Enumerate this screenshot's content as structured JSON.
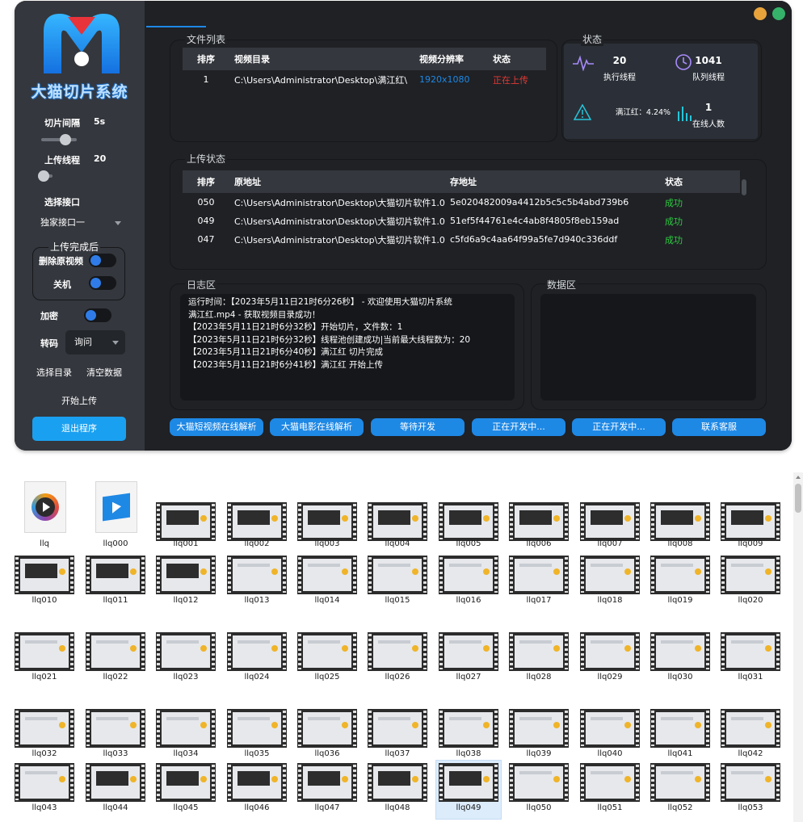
{
  "window": {
    "min_color": "#e8a33b",
    "max_color": "#36b36a"
  },
  "sidebar": {
    "brand": "大猫切片系统",
    "slice_interval_label": "切片间隔",
    "slice_interval_value": "5s",
    "slice_interval_level": 0.55,
    "upload_threads_label": "上传线程",
    "upload_threads_value": "20",
    "upload_threads_level": 0.05,
    "choose_api_label": "选择接口",
    "api_select_value": "独家接口一",
    "after_upload_title": "上传完成后",
    "delete_source_label": "删除原视频",
    "shutdown_label": "关机",
    "encrypt_label": "加密",
    "transcode_label": "转码",
    "transcode_select_value": "询问",
    "choose_dir_label": "选择目录",
    "clear_data_label": "清空数据",
    "start_upload_label": "开始上传",
    "quit_label": "退出程序"
  },
  "file_list": {
    "title": "文件列表",
    "headers": [
      "排序",
      "视频目录",
      "视频分辨率",
      "状态"
    ],
    "rows": [
      {
        "index": "1",
        "dir": "C:\\Users\\Administrator\\Desktop\\满江红\\",
        "resolution": "1920x1080",
        "status": "正在上传"
      }
    ]
  },
  "status": {
    "title": "状态",
    "exec_threads_value": "20",
    "exec_threads_label": "执行线程",
    "queue_threads_value": "1041",
    "queue_threads_label": "队列线程",
    "progress_text": "满江红：4.24%",
    "online_value": "1",
    "online_label": "在线人数"
  },
  "upload_status": {
    "title": "上传状态",
    "headers": [
      "排序",
      "原地址",
      "存地址",
      "状态"
    ],
    "rows": [
      {
        "index": "050",
        "src": "C:\\Users\\Administrator\\Desktop\\大猫切片软件1.0",
        "dst": "5e020482009a4412b5c5c5b4abd739b6",
        "status": "成功"
      },
      {
        "index": "049",
        "src": "C:\\Users\\Administrator\\Desktop\\大猫切片软件1.0",
        "dst": "51ef5f44761e4c4ab8f4805f8eb159ad",
        "status": "成功"
      },
      {
        "index": "047",
        "src": "C:\\Users\\Administrator\\Desktop\\大猫切片软件1.0",
        "dst": "c5fd6a9c4aa64f99a5fe7d940c336ddf",
        "status": "成功"
      }
    ]
  },
  "log": {
    "title": "日志区",
    "lines": [
      "运行时间：【2023年5月11日21时6分26秒】 - 欢迎使用大猫切片系统",
      "满江红.mp4 - 获取视频目录成功！",
      "【2023年5月11日21时6分32秒】开始切片，文件数：1",
      "【2023年5月11日21时6分32秒】线程池创建成功|当前最大线程数为：20",
      "【2023年5月11日21时6分40秒】满江红 切片完成",
      "【2023年5月11日21时6分41秒】满江红 开始上传"
    ]
  },
  "data_area": {
    "title": "数据区"
  },
  "bottom_buttons": [
    "大猫短视频在线解析",
    "大猫电影在线解析",
    "等待开发",
    "正在开发中...",
    "正在开发中...",
    "联系客服"
  ],
  "explorer": {
    "files": [
      "llq",
      "llq000",
      "llq001",
      "llq002",
      "llq003",
      "llq004",
      "llq005",
      "llq006",
      "llq007",
      "llq008",
      "llq009",
      "llq010",
      "llq011",
      "llq012",
      "llq013",
      "llq014",
      "llq015",
      "llq016",
      "llq017",
      "llq018",
      "llq019",
      "llq020",
      "llq021",
      "llq022",
      "llq023",
      "llq024",
      "llq025",
      "llq026",
      "llq027",
      "llq028",
      "llq029",
      "llq030",
      "llq031",
      "llq032",
      "llq033",
      "llq034",
      "llq035",
      "llq036",
      "llq037",
      "llq038",
      "llq039",
      "llq040",
      "llq041",
      "llq042",
      "llq043",
      "llq044",
      "llq045",
      "llq046",
      "llq047",
      "llq048",
      "llq049",
      "llq050",
      "llq051",
      "llq052",
      "llq053"
    ],
    "selected": "llq049"
  }
}
